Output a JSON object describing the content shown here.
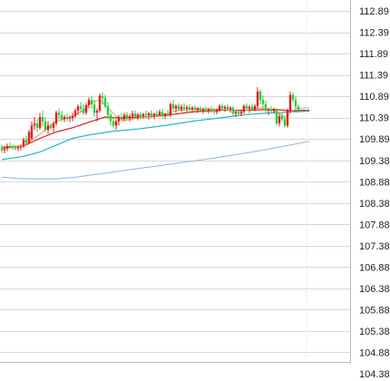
{
  "chart_data": {
    "type": "candlestick",
    "title": "",
    "xlabel": "",
    "ylabel": "",
    "ylim": [
      104.38,
      112.89
    ],
    "grid": true,
    "y_ticks": [
      "112.89",
      "112.39",
      "111.89",
      "111.39",
      "110.89",
      "110.39",
      "109.89",
      "109.38",
      "108.88",
      "108.38",
      "107.88",
      "107.38",
      "106.88",
      "106.38",
      "105.88",
      "105.38",
      "104.88",
      "104.38"
    ],
    "colors": {
      "up": "#e31a1c",
      "down": "#2ecc40",
      "ma_short": "#e0a060",
      "ma_mid": "#d62020",
      "ma_long": "#21b6c8",
      "ma_extra": "#8fb4e0",
      "grid": "#d8d8d8",
      "axis": "#bbbbbb"
    },
    "ohlc": [
      [
        109.68,
        109.74,
        109.56,
        109.62
      ],
      [
        109.62,
        109.71,
        109.55,
        109.66
      ],
      [
        109.66,
        109.78,
        109.6,
        109.72
      ],
      [
        109.72,
        109.8,
        109.64,
        109.7
      ],
      [
        109.7,
        109.76,
        109.63,
        109.68
      ],
      [
        109.68,
        109.74,
        109.61,
        109.66
      ],
      [
        109.66,
        109.73,
        109.6,
        109.69
      ],
      [
        109.69,
        109.76,
        109.62,
        109.71
      ],
      [
        109.71,
        109.92,
        109.68,
        109.86
      ],
      [
        109.86,
        109.96,
        109.76,
        109.8
      ],
      [
        109.8,
        110.1,
        109.78,
        110.05
      ],
      [
        109.9,
        110.3,
        109.85,
        110.2
      ],
      [
        110.2,
        110.4,
        110.1,
        110.25
      ],
      [
        110.25,
        110.35,
        110.05,
        110.15
      ],
      [
        110.15,
        110.5,
        110.1,
        110.4
      ],
      [
        110.4,
        110.55,
        110.2,
        110.3
      ],
      [
        110.3,
        110.4,
        110.05,
        110.1
      ],
      [
        110.1,
        110.3,
        110.0,
        110.2
      ],
      [
        110.2,
        110.25,
        110.1,
        110.15
      ],
      [
        110.15,
        110.3,
        110.05,
        110.25
      ],
      [
        110.25,
        110.55,
        110.2,
        110.5
      ],
      [
        110.5,
        110.6,
        110.35,
        110.45
      ],
      [
        110.45,
        110.55,
        110.3,
        110.35
      ],
      [
        110.35,
        110.45,
        110.28,
        110.4
      ],
      [
        110.4,
        110.48,
        110.3,
        110.36
      ],
      [
        110.36,
        110.44,
        110.28,
        110.38
      ],
      [
        110.38,
        110.5,
        110.3,
        110.42
      ],
      [
        110.42,
        110.6,
        110.38,
        110.55
      ],
      [
        110.55,
        110.7,
        110.45,
        110.65
      ],
      [
        110.65,
        110.75,
        110.5,
        110.6
      ],
      [
        110.6,
        110.7,
        110.45,
        110.5
      ],
      [
        110.5,
        110.72,
        110.45,
        110.68
      ],
      [
        110.68,
        110.86,
        110.6,
        110.8
      ],
      [
        110.8,
        110.9,
        110.6,
        110.7
      ],
      [
        110.7,
        110.8,
        110.4,
        110.5
      ],
      [
        110.5,
        110.6,
        110.3,
        110.55
      ],
      [
        110.55,
        110.95,
        110.5,
        110.9
      ],
      [
        110.9,
        110.98,
        110.7,
        110.85
      ],
      [
        110.85,
        110.92,
        110.6,
        110.65
      ],
      [
        110.65,
        110.75,
        110.35,
        110.45
      ],
      [
        110.45,
        110.5,
        110.2,
        110.3
      ],
      [
        110.3,
        110.4,
        110.15,
        110.2
      ],
      [
        110.2,
        110.35,
        110.1,
        110.3
      ],
      [
        110.3,
        110.45,
        110.2,
        110.4
      ],
      [
        110.4,
        110.48,
        110.28,
        110.35
      ],
      [
        110.35,
        110.5,
        110.3,
        110.45
      ],
      [
        110.45,
        110.52,
        110.33,
        110.4
      ],
      [
        110.4,
        110.47,
        110.3,
        110.42
      ],
      [
        110.42,
        110.55,
        110.35,
        110.48
      ],
      [
        110.48,
        110.55,
        110.36,
        110.4
      ],
      [
        110.4,
        110.5,
        110.33,
        110.46
      ],
      [
        110.46,
        110.52,
        110.35,
        110.42
      ],
      [
        110.42,
        110.5,
        110.36,
        110.47
      ],
      [
        110.47,
        110.55,
        110.38,
        110.44
      ],
      [
        110.44,
        110.52,
        110.34,
        110.49
      ],
      [
        110.49,
        110.56,
        110.38,
        110.43
      ],
      [
        110.43,
        110.5,
        110.35,
        110.48
      ],
      [
        110.48,
        110.55,
        110.4,
        110.45
      ],
      [
        110.45,
        110.58,
        110.42,
        110.52
      ],
      [
        110.52,
        110.6,
        110.38,
        110.42
      ],
      [
        110.42,
        110.5,
        110.36,
        110.48
      ],
      [
        110.48,
        110.56,
        110.4,
        110.44
      ],
      [
        110.44,
        110.74,
        110.4,
        110.7
      ],
      [
        110.7,
        110.8,
        110.55,
        110.6
      ],
      [
        110.6,
        110.7,
        110.5,
        110.66
      ],
      [
        110.66,
        110.72,
        110.54,
        110.58
      ],
      [
        110.58,
        110.7,
        110.52,
        110.64
      ],
      [
        110.64,
        110.72,
        110.55,
        110.6
      ],
      [
        110.6,
        110.68,
        110.52,
        110.63
      ],
      [
        110.63,
        110.7,
        110.54,
        110.58
      ],
      [
        110.58,
        110.66,
        110.5,
        110.62
      ],
      [
        110.62,
        110.68,
        110.52,
        110.56
      ],
      [
        110.56,
        110.64,
        110.5,
        110.6
      ],
      [
        110.6,
        110.66,
        110.52,
        110.55
      ],
      [
        110.55,
        110.62,
        110.48,
        110.58
      ],
      [
        110.58,
        110.64,
        110.5,
        110.54
      ],
      [
        110.54,
        110.62,
        110.48,
        110.58
      ],
      [
        110.58,
        110.65,
        110.5,
        110.55
      ],
      [
        110.55,
        110.62,
        110.46,
        110.52
      ],
      [
        110.52,
        110.6,
        110.46,
        110.56
      ],
      [
        110.56,
        110.7,
        110.52,
        110.66
      ],
      [
        110.66,
        110.72,
        110.55,
        110.6
      ],
      [
        110.6,
        110.68,
        110.52,
        110.64
      ],
      [
        110.64,
        110.7,
        110.54,
        110.58
      ],
      [
        110.58,
        110.66,
        110.5,
        110.62
      ],
      [
        110.62,
        110.66,
        110.42,
        110.48
      ],
      [
        110.48,
        110.55,
        110.4,
        110.52
      ],
      [
        110.52,
        110.58,
        110.44,
        110.48
      ],
      [
        110.48,
        110.56,
        110.42,
        110.52
      ],
      [
        110.52,
        110.7,
        110.48,
        110.66
      ],
      [
        110.66,
        110.72,
        110.56,
        110.6
      ],
      [
        110.6,
        110.68,
        110.5,
        110.64
      ],
      [
        110.64,
        110.72,
        110.54,
        110.58
      ],
      [
        110.58,
        110.7,
        110.54,
        110.66
      ],
      [
        110.66,
        111.1,
        110.6,
        111.0
      ],
      [
        111.0,
        111.05,
        110.7,
        110.8
      ],
      [
        110.8,
        110.9,
        110.6,
        110.7
      ],
      [
        110.7,
        110.78,
        110.5,
        110.55
      ],
      [
        110.55,
        110.62,
        110.45,
        110.58
      ],
      [
        110.58,
        110.66,
        110.5,
        110.54
      ],
      [
        110.54,
        110.62,
        110.48,
        110.58
      ],
      [
        110.58,
        110.6,
        110.2,
        110.25
      ],
      [
        110.25,
        110.48,
        110.18,
        110.42
      ],
      [
        110.42,
        110.5,
        110.3,
        110.35
      ],
      [
        110.35,
        110.4,
        110.15,
        110.2
      ],
      [
        110.2,
        110.6,
        110.15,
        110.55
      ],
      [
        110.55,
        111.0,
        110.5,
        110.92
      ],
      [
        110.92,
        110.98,
        110.75,
        110.8
      ],
      [
        110.8,
        110.88,
        110.6,
        110.65
      ],
      [
        110.65,
        110.7,
        110.5,
        110.55
      ]
    ],
    "ma_short": [
      [
        0,
        109.7
      ],
      [
        8,
        109.72
      ],
      [
        14,
        110.0
      ],
      [
        20,
        110.3
      ],
      [
        26,
        110.42
      ],
      [
        30,
        110.55
      ],
      [
        33,
        110.75
      ],
      [
        36,
        110.8
      ],
      [
        39,
        110.62
      ],
      [
        42,
        110.42
      ],
      [
        45,
        110.32
      ],
      [
        52,
        110.4
      ],
      [
        60,
        110.46
      ],
      [
        64,
        110.55
      ],
      [
        72,
        110.6
      ],
      [
        80,
        110.58
      ],
      [
        88,
        110.54
      ],
      [
        95,
        110.62
      ],
      [
        100,
        110.55
      ],
      [
        104,
        110.4
      ],
      [
        108,
        110.6
      ],
      [
        113,
        110.62
      ]
    ],
    "ma_mid": [
      [
        0,
        109.68
      ],
      [
        8,
        109.72
      ],
      [
        14,
        109.9
      ],
      [
        20,
        110.05
      ],
      [
        26,
        110.15
      ],
      [
        32,
        110.28
      ],
      [
        38,
        110.4
      ],
      [
        44,
        110.38
      ],
      [
        52,
        110.4
      ],
      [
        60,
        110.44
      ],
      [
        70,
        110.52
      ],
      [
        80,
        110.56
      ],
      [
        90,
        110.56
      ],
      [
        100,
        110.58
      ],
      [
        106,
        110.55
      ],
      [
        113,
        110.56
      ]
    ],
    "ma_long": [
      [
        0,
        109.4
      ],
      [
        8,
        109.48
      ],
      [
        14,
        109.58
      ],
      [
        20,
        109.74
      ],
      [
        26,
        109.9
      ],
      [
        32,
        109.98
      ],
      [
        40,
        110.06
      ],
      [
        50,
        110.12
      ],
      [
        60,
        110.2
      ],
      [
        70,
        110.3
      ],
      [
        80,
        110.38
      ],
      [
        90,
        110.46
      ],
      [
        100,
        110.5
      ],
      [
        106,
        110.52
      ],
      [
        113,
        110.54
      ]
    ],
    "ma_extra": [
      [
        0,
        108.99
      ],
      [
        6,
        108.96
      ],
      [
        12,
        108.95
      ],
      [
        20,
        108.95
      ],
      [
        26,
        108.98
      ],
      [
        34,
        109.05
      ],
      [
        44,
        109.14
      ],
      [
        60,
        109.28
      ],
      [
        76,
        109.42
      ],
      [
        92,
        109.58
      ],
      [
        104,
        109.72
      ],
      [
        113,
        109.83
      ]
    ]
  }
}
